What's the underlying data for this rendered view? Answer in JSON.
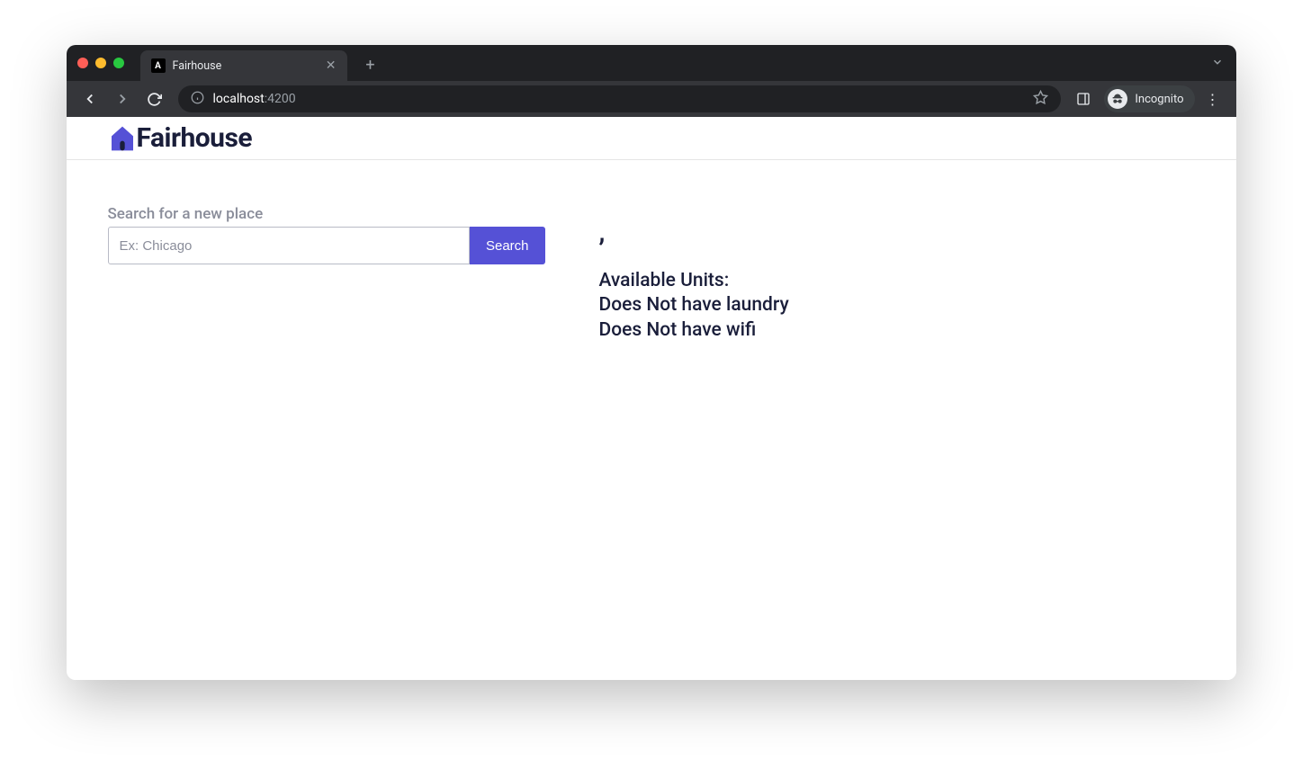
{
  "browser": {
    "tab_title": "Fairhouse",
    "tab_favicon_letter": "A",
    "url_host": "localhost",
    "url_port": ":4200",
    "incognito_label": "Incognito"
  },
  "header": {
    "brand_name": "Fairhouse"
  },
  "search": {
    "label": "Search for a new place",
    "placeholder": "Ex: Chicago",
    "button_label": "Search",
    "input_value": ""
  },
  "details": {
    "heading": ",",
    "available_units": "Available Units:",
    "laundry": "Does Not have laundry",
    "wifi": "Does Not have wifi"
  },
  "colors": {
    "accent": "#5551d6",
    "text_dark": "#1a1e3a",
    "text_muted": "#8a8d9a"
  }
}
